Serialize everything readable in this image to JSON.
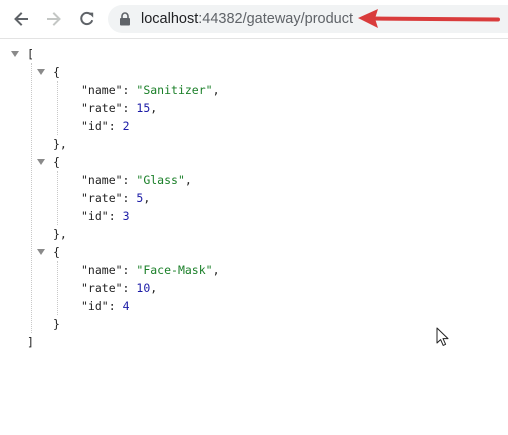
{
  "browser": {
    "url_host": "localhost",
    "url_path": ":44382/gateway/product",
    "icons": {
      "back": "back-arrow-icon",
      "forward": "forward-arrow-icon",
      "reload": "reload-icon",
      "lock": "lock-icon"
    },
    "annotation_color": "#d93c3c"
  },
  "json": {
    "open_bracket": "[",
    "close_bracket": "]",
    "open_brace": "{",
    "close_brace_comma": "},",
    "close_brace": "}",
    "items": [
      {
        "name_key": "\"name\"",
        "name_value": "\"Sanitizer\"",
        "rate_key": "\"rate\"",
        "rate_value": "15",
        "id_key": "\"id\"",
        "id_value": "2"
      },
      {
        "name_key": "\"name\"",
        "name_value": "\"Glass\"",
        "rate_key": "\"rate\"",
        "rate_value": "5",
        "id_key": "\"id\"",
        "id_value": "3"
      },
      {
        "name_key": "\"name\"",
        "name_value": "\"Face-Mask\"",
        "rate_key": "\"rate\"",
        "rate_value": "10",
        "id_key": "\"id\"",
        "id_value": "4"
      }
    ]
  }
}
